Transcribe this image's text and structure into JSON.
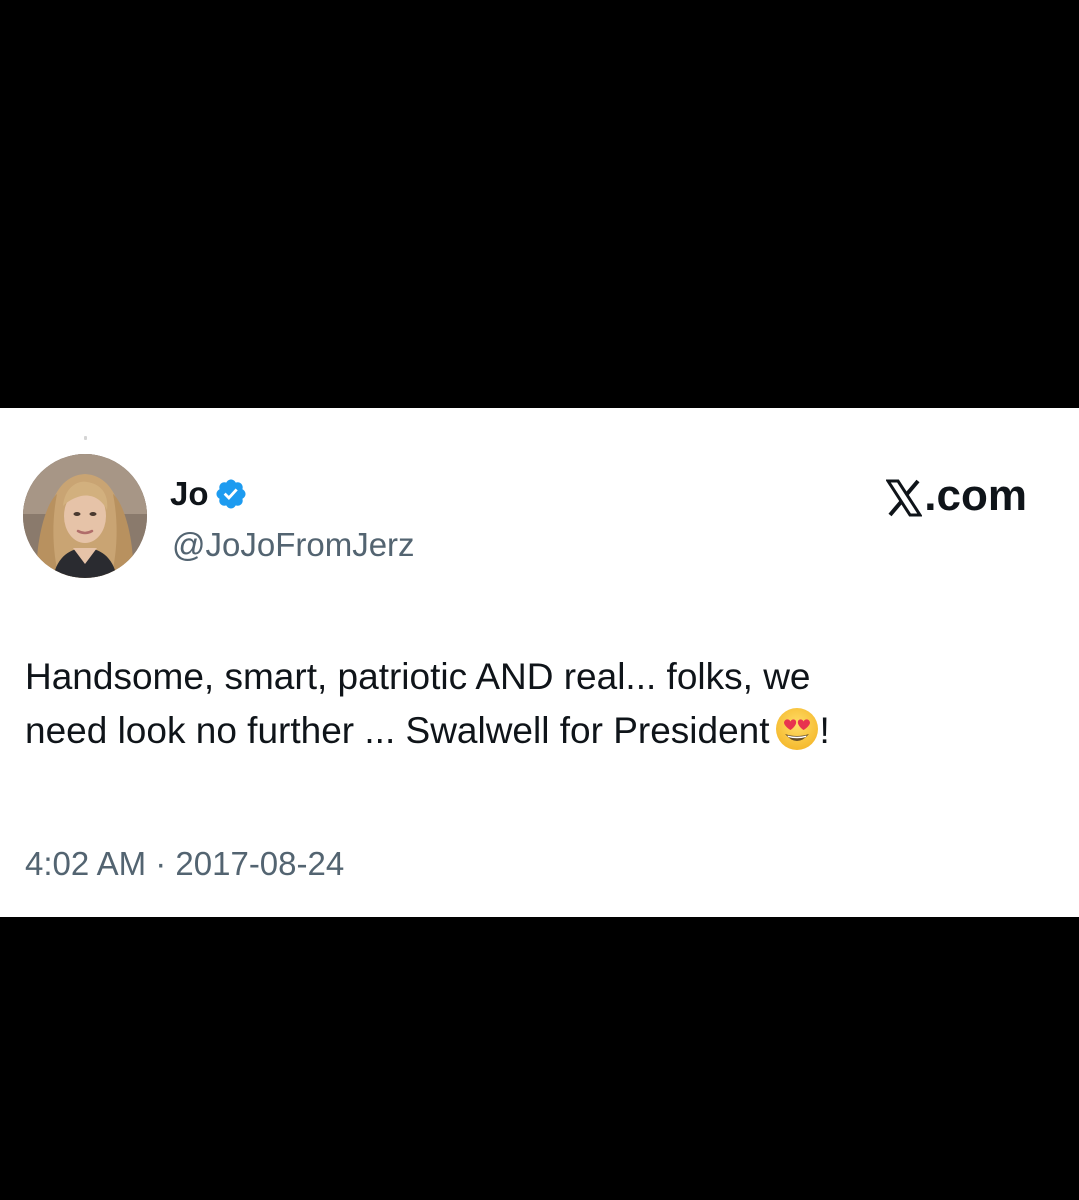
{
  "tweet": {
    "author": {
      "display_name": "Jo",
      "handle": "@JoJoFromJerz",
      "verified": true,
      "verified_color": "#1d9bf0"
    },
    "brand": {
      "text": ".com",
      "logo_icon": "x-logo-icon"
    },
    "text_lines": [
      "Handsome, smart, patriotic AND real... folks, we",
      "need look no further ... Swalwell for President"
    ],
    "text_suffix": "!",
    "emoji_icon": "heart-eyes-emoji-icon",
    "timestamp": "4:02 AM · 2017-08-24"
  },
  "colors": {
    "background": "#000000",
    "card": "#ffffff",
    "text_primary": "#0f1419",
    "text_secondary": "#536471"
  }
}
